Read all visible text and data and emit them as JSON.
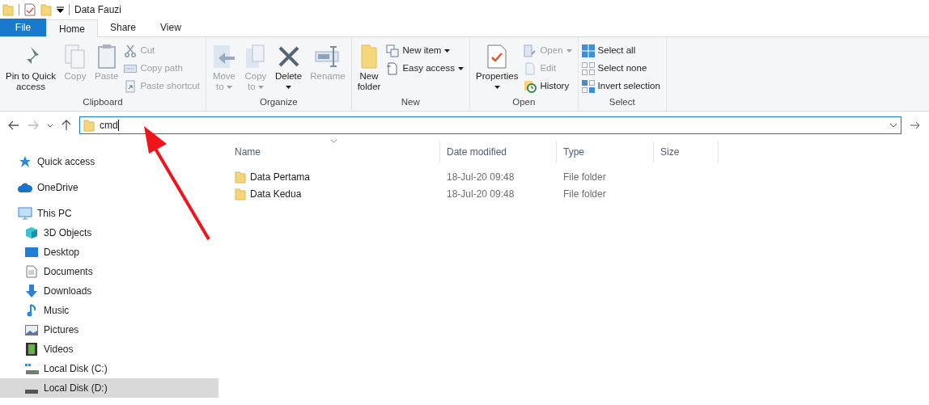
{
  "window": {
    "title": "Data Fauzi"
  },
  "tabs": [
    {
      "label": "File",
      "kind": "file",
      "selected": false
    },
    {
      "label": "Home",
      "kind": "tab",
      "selected": true
    },
    {
      "label": "Share",
      "kind": "tab",
      "selected": false
    },
    {
      "label": "View",
      "kind": "tab",
      "selected": false
    }
  ],
  "ribbon": {
    "groups": [
      {
        "label": "Clipboard",
        "buttons": [
          {
            "kind": "large",
            "lines": [
              "Pin to Quick",
              "access"
            ],
            "disabled": false,
            "menu": false
          },
          {
            "kind": "large",
            "lines": [
              "Copy"
            ],
            "disabled": true,
            "menu": false
          },
          {
            "kind": "large",
            "lines": [
              "Paste"
            ],
            "disabled": true,
            "menu": false
          },
          {
            "kind": "small",
            "lines": [
              "Cut"
            ],
            "disabled": true,
            "menu": false
          },
          {
            "kind": "small",
            "lines": [
              "Copy path"
            ],
            "disabled": true,
            "menu": false
          },
          {
            "kind": "small",
            "lines": [
              "Paste shortcut"
            ],
            "disabled": true,
            "menu": false
          }
        ]
      },
      {
        "label": "Organize",
        "buttons": [
          {
            "kind": "large",
            "lines": [
              "Move",
              "to"
            ],
            "disabled": true,
            "menu": true
          },
          {
            "kind": "large",
            "lines": [
              "Copy",
              "to"
            ],
            "disabled": true,
            "menu": true
          },
          {
            "kind": "large",
            "lines": [
              "Delete"
            ],
            "disabled": false,
            "menu": true
          },
          {
            "kind": "large",
            "lines": [
              "Rename"
            ],
            "disabled": true,
            "menu": false
          }
        ]
      },
      {
        "label": "New",
        "buttons": [
          {
            "kind": "large",
            "lines": [
              "New",
              "folder"
            ],
            "disabled": false,
            "menu": false
          },
          {
            "kind": "small",
            "lines": [
              "New item"
            ],
            "disabled": false,
            "menu": true
          },
          {
            "kind": "small",
            "lines": [
              "Easy access"
            ],
            "disabled": false,
            "menu": true
          }
        ]
      },
      {
        "label": "Open",
        "buttons": [
          {
            "kind": "large",
            "lines": [
              "Properties"
            ],
            "disabled": false,
            "menu": true
          },
          {
            "kind": "small",
            "lines": [
              "Open"
            ],
            "disabled": true,
            "menu": true
          },
          {
            "kind": "small",
            "lines": [
              "Edit"
            ],
            "disabled": true,
            "menu": false
          },
          {
            "kind": "small",
            "lines": [
              "History"
            ],
            "disabled": false,
            "menu": false
          }
        ]
      },
      {
        "label": "Select",
        "buttons": [
          {
            "kind": "small",
            "lines": [
              "Select all"
            ],
            "disabled": false,
            "menu": false
          },
          {
            "kind": "small",
            "lines": [
              "Select none"
            ],
            "disabled": false,
            "menu": false
          },
          {
            "kind": "small",
            "lines": [
              "Invert selection"
            ],
            "disabled": false,
            "menu": false
          }
        ]
      }
    ]
  },
  "address_bar": {
    "value": "cmd"
  },
  "sidebar": {
    "items": [
      {
        "label": "Quick access",
        "selected": false
      },
      {
        "label": "OneDrive",
        "selected": false
      },
      {
        "label": "This PC",
        "selected": false,
        "children": [
          {
            "label": "3D Objects",
            "selected": false
          },
          {
            "label": "Desktop",
            "selected": false
          },
          {
            "label": "Documents",
            "selected": false
          },
          {
            "label": "Downloads",
            "selected": false
          },
          {
            "label": "Music",
            "selected": false
          },
          {
            "label": "Pictures",
            "selected": false
          },
          {
            "label": "Videos",
            "selected": false
          },
          {
            "label": "Local Disk (C:)",
            "selected": false
          },
          {
            "label": "Local Disk (D:)",
            "selected": true
          }
        ]
      }
    ]
  },
  "table": {
    "columns": [
      "Name",
      "Date modified",
      "Type",
      "Size"
    ],
    "rows": [
      [
        "Data Pertama",
        "18-Jul-20 09:48",
        "File folder"
      ],
      [
        "Data Kedua",
        "18-Jul-20 09:48",
        "File folder"
      ]
    ]
  }
}
